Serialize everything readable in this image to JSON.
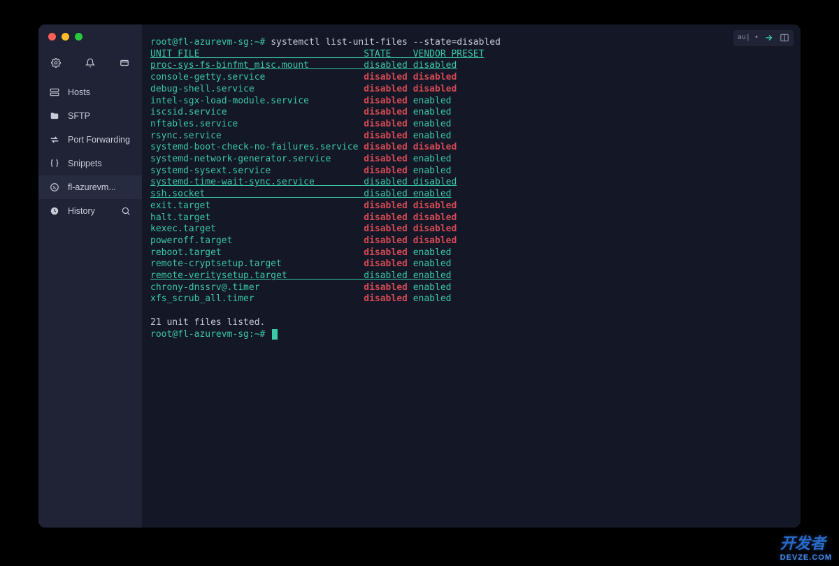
{
  "sidebar": {
    "items": [
      {
        "label": "Hosts"
      },
      {
        "label": "SFTP"
      },
      {
        "label": "Port Forwarding"
      },
      {
        "label": "Snippets"
      },
      {
        "label": "fl-azurevm..."
      },
      {
        "label": "History"
      }
    ]
  },
  "terminal": {
    "controls_text": "au| •",
    "prompt_user": "root@fl-azurevm-sg",
    "prompt_path": "~",
    "prompt_symbol": "#",
    "command": "systemctl list-unit-files --state=disabled",
    "header": {
      "unit": "UNIT FILE",
      "state": "STATE",
      "preset": "VENDOR PRESET"
    },
    "rows": [
      {
        "unit": "proc-sys-fs-binfmt_misc.mount",
        "state": "disabled",
        "preset": "disabled",
        "style": "linked"
      },
      {
        "unit": "console-getty.service",
        "state": "disabled",
        "preset": "disabled",
        "style": "red-red"
      },
      {
        "unit": "debug-shell.service",
        "state": "disabled",
        "preset": "disabled",
        "style": "red-red"
      },
      {
        "unit": "intel-sgx-load-module.service",
        "state": "disabled",
        "preset": "enabled",
        "style": "red-green"
      },
      {
        "unit": "iscsid.service",
        "state": "disabled",
        "preset": "enabled",
        "style": "red-green"
      },
      {
        "unit": "nftables.service",
        "state": "disabled",
        "preset": "enabled",
        "style": "red-green"
      },
      {
        "unit": "rsync.service",
        "state": "disabled",
        "preset": "enabled",
        "style": "red-green"
      },
      {
        "unit": "systemd-boot-check-no-failures.service",
        "state": "disabled",
        "preset": "disabled",
        "style": "red-red"
      },
      {
        "unit": "systemd-network-generator.service",
        "state": "disabled",
        "preset": "enabled",
        "style": "red-green"
      },
      {
        "unit": "systemd-sysext.service",
        "state": "disabled",
        "preset": "enabled",
        "style": "red-green"
      },
      {
        "unit": "systemd-time-wait-sync.service",
        "state": "disabled",
        "preset": "disabled",
        "style": "linked"
      },
      {
        "unit": "ssh.socket",
        "state": "disabled",
        "preset": "enabled",
        "style": "linked"
      },
      {
        "unit": "exit.target",
        "state": "disabled",
        "preset": "disabled",
        "style": "red-red"
      },
      {
        "unit": "halt.target",
        "state": "disabled",
        "preset": "disabled",
        "style": "red-red"
      },
      {
        "unit": "kexec.target",
        "state": "disabled",
        "preset": "disabled",
        "style": "red-red"
      },
      {
        "unit": "poweroff.target",
        "state": "disabled",
        "preset": "disabled",
        "style": "red-red"
      },
      {
        "unit": "reboot.target",
        "state": "disabled",
        "preset": "enabled",
        "style": "red-green"
      },
      {
        "unit": "remote-cryptsetup.target",
        "state": "disabled",
        "preset": "enabled",
        "style": "red-green"
      },
      {
        "unit": "remote-veritysetup.target",
        "state": "disabled",
        "preset": "enabled",
        "style": "linked"
      },
      {
        "unit": "chrony-dnssrv@.timer",
        "state": "disabled",
        "preset": "enabled",
        "style": "red-green"
      },
      {
        "unit": "xfs_scrub_all.timer",
        "state": "disabled",
        "preset": "enabled",
        "style": "red-green"
      }
    ],
    "summary": "21 unit files listed.",
    "columns": {
      "unit_width": 39,
      "state_width": 9
    }
  },
  "watermark": {
    "main": "开发者",
    "sub": "DEVZE.COM"
  }
}
